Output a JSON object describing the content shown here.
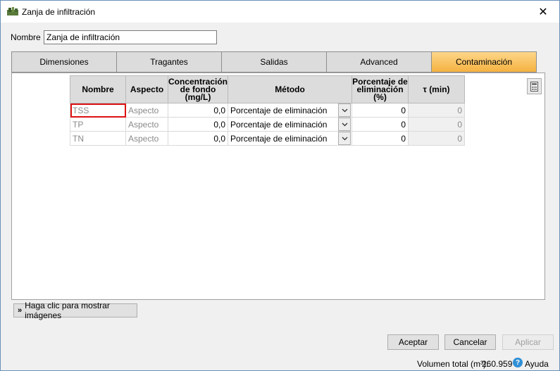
{
  "window": {
    "title": "Zanja de infiltración",
    "close_glyph": "✕"
  },
  "name_field": {
    "label": "Nombre",
    "value": "Zanja de infiltración"
  },
  "tabs": [
    {
      "label": "Dimensiones",
      "active": false
    },
    {
      "label": "Tragantes",
      "active": false
    },
    {
      "label": "Salidas",
      "active": false
    },
    {
      "label": "Advanced",
      "active": false
    },
    {
      "label": "Contaminación",
      "active": true
    }
  ],
  "grid": {
    "headers": {
      "nombre": "Nombre",
      "aspecto": "Aspecto",
      "concentracion": "Concentración de fondo (mg/L)",
      "metodo": "Método",
      "porcentaje": "Porcentaje de eliminación (%)",
      "tau": "τ (min)"
    },
    "rows": [
      {
        "nombre": "TSS",
        "aspecto": "Aspecto",
        "concentracion": "0,0",
        "metodo": "Porcentaje de eliminación",
        "porcentaje": "0",
        "tau": "0"
      },
      {
        "nombre": "TP",
        "aspecto": "Aspecto",
        "concentracion": "0,0",
        "metodo": "Porcentaje de eliminación",
        "porcentaje": "0",
        "tau": "0"
      },
      {
        "nombre": "TN",
        "aspecto": "Aspecto",
        "concentracion": "0,0",
        "metodo": "Porcentaje de eliminación",
        "porcentaje": "0",
        "tau": "0"
      }
    ]
  },
  "show_images_label": "Haga clic para mostrar imágenes",
  "buttons": {
    "accept": "Aceptar",
    "cancel": "Cancelar",
    "apply": "Aplicar"
  },
  "status": {
    "volume_label": "Volumen total (m³):",
    "volume_value": "260.959",
    "help": "Ayuda"
  },
  "colors": {
    "active_tab": "#f5b240",
    "selection_border": "#d11111",
    "help_icon": "#2f8fd6"
  },
  "icons": [
    "app-icon",
    "close-icon",
    "calculator-icon",
    "chevron-down-icon",
    "double-chevron-down-icon",
    "help-icon"
  ]
}
